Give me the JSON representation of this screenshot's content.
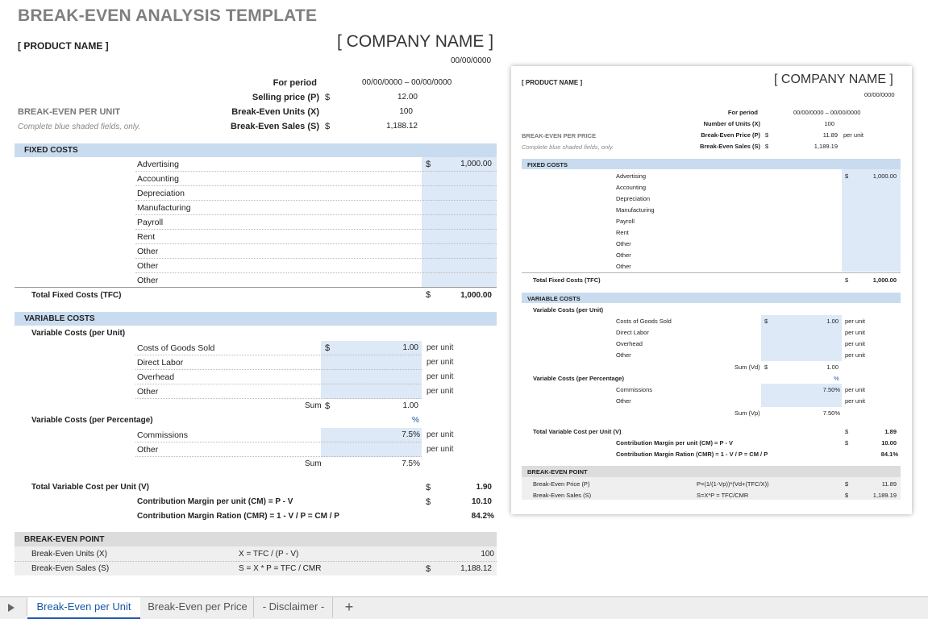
{
  "title": "BREAK-EVEN ANALYSIS TEMPLATE",
  "product_name": "[ PRODUCT NAME ]",
  "company_name": "[ COMPANY NAME ]",
  "date": "00/00/0000",
  "info": {
    "for_period_label": "For period",
    "for_period_value": "00/00/0000 – 00/00/0000",
    "selling_price_label": "Selling price (P)",
    "selling_price_value": "12.00",
    "be_units_label": "Break-Even Units (X)",
    "be_units_value": "100",
    "be_sales_label": "Break-Even Sales (S)",
    "be_sales_value": "1,188.12",
    "currency": "$"
  },
  "be_per_unit_heading": "BREAK-EVEN PER UNIT",
  "complete_note": "Complete blue shaded fields, only.",
  "fixed": {
    "heading": "FIXED COSTS",
    "items": [
      "Advertising",
      "Accounting",
      "Depreciation",
      "Manufacturing",
      "Payroll",
      "Rent",
      "Other",
      "Other",
      "Other"
    ],
    "first_value": "1,000.00",
    "total_label": "Total Fixed Costs (TFC)",
    "total_value": "1,000.00"
  },
  "variable": {
    "heading": "VARIABLE COSTS",
    "per_unit_label": "Variable Costs (per Unit)",
    "unit_items": [
      "Costs of Goods Sold",
      "Direct Labor",
      "Overhead",
      "Other"
    ],
    "first_unit_value": "1.00",
    "per_unit": "per unit",
    "sum_label": "Sum",
    "sum_value": "1.00",
    "pct_symbol": "%",
    "per_pct_label": "Variable Costs (per Percentage)",
    "pct_items": [
      "Commissions",
      "Other"
    ],
    "first_pct_value": "7.5%",
    "pct_sum_value": "7.5%",
    "tvc_label": "Total Variable Cost per Unit (V)",
    "tvc_value": "1.90",
    "cm_label": "Contribution Margin per unit (CM) = P - V",
    "cm_value": "10.10",
    "cmr_label": "Contribution Margin Ration (CMR) = 1 - V / P = CM / P",
    "cmr_value": "84.2%"
  },
  "bep": {
    "heading": "BREAK-EVEN POINT",
    "units_label": "Break-Even Units (X)",
    "units_formula": "X = TFC / (P - V)",
    "units_value": "100",
    "sales_label": "Break-Even Sales (S)",
    "sales_formula": "S = X * P = TFC / CMR",
    "sales_value": "1,188.12"
  },
  "preview": {
    "product_name": "[ PRODUCT NAME ]",
    "company_name": "[ COMPANY NAME ]",
    "date": "00/00/0000",
    "for_period_label": "For period",
    "for_period_value": "00/00/0000 – 00/00/0000",
    "units_label": "Number of Units (X)",
    "units_value": "100",
    "price_label": "Break-Even Price (P)",
    "price_value": "11.89",
    "per_unit": "per unit",
    "sales_label": "Break-Even Sales (S)",
    "sales_value": "1,189.19",
    "heading": "BREAK-EVEN PER PRICE",
    "note": "Complete blue shaded fields, only.",
    "fixed_heading": "FIXED COSTS",
    "fixed_items": [
      "Advertising",
      "Accounting",
      "Depreciation",
      "Manufacturing",
      "Payroll",
      "Rent",
      "Other",
      "Other",
      "Other"
    ],
    "fixed_first": "1,000.00",
    "tfc_label": "Total Fixed Costs (TFC)",
    "tfc_value": "1,000.00",
    "var_heading": "VARIABLE COSTS",
    "var_unit_label": "Variable Costs (per Unit)",
    "var_items": [
      "Costs of Goods Sold",
      "Direct Labor",
      "Overhead",
      "Other"
    ],
    "var_first": "1.00",
    "sum_vd_label": "Sum (Vd)",
    "sum_vd_value": "1.00",
    "pct_symbol": "%",
    "var_pct_label": "Variable Costs (per Percentage)",
    "pct_items": [
      "Commissions",
      "Other"
    ],
    "pct_first": "7.50%",
    "sum_vp_label": "Sum (Vp)",
    "sum_vp_value": "7.50%",
    "tvc_label": "Total Variable Cost per Unit (V)",
    "tvc_value": "1.89",
    "cm_label": "Contribution Margin per unit (CM) = P - V",
    "cm_value": "10.00",
    "cmr_label": "Contribution Margin Ration (CMR) = 1 - V / P = CM / P",
    "cmr_value": "84.1%",
    "bep_heading": "BREAK-EVEN POINT",
    "bep_price_label": "Break-Even Price (P)",
    "bep_price_formula": "P=(1/(1-Vp))*(Vd+(TFC/X))",
    "bep_price_value": "11.89",
    "bep_sales_label": "Break-Even Sales (S)",
    "bep_sales_formula": "S=X*P = TFC/CMR",
    "bep_sales_value": "1,189.19"
  },
  "tabs": {
    "nav_icon": "play-triangle-icon",
    "items": [
      "Break-Even per Unit",
      "Break-Even per Price",
      "- Disclaimer -"
    ],
    "add": "+"
  }
}
